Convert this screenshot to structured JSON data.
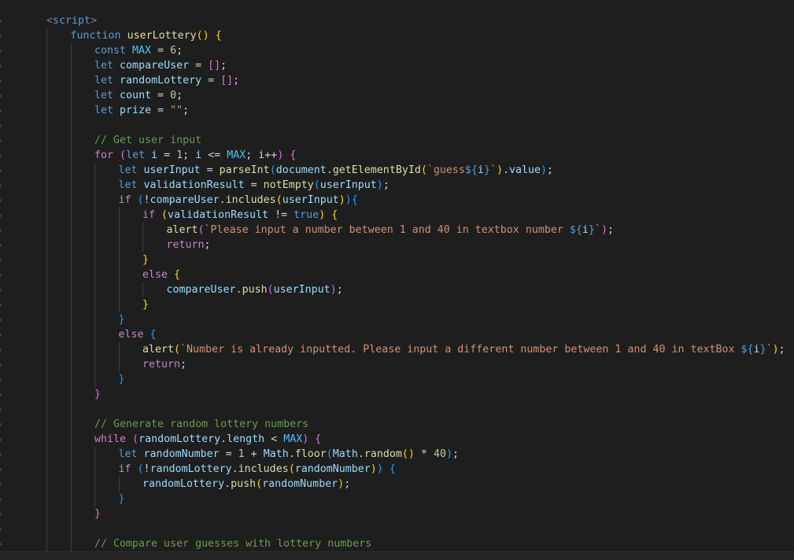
{
  "editor": {
    "language": "javascript",
    "theme_colors": {
      "background": "#1e1e1e",
      "keyword": "#569cd6",
      "control": "#c586c0",
      "function": "#dcdcaa",
      "variable": "#9cdcfe",
      "constant": "#4fc1ff",
      "number": "#b5cea8",
      "string": "#ce9178",
      "comment": "#6a9955",
      "bracket_level_1": "#ffd700",
      "bracket_level_2": "#da70d6",
      "bracket_level_3": "#179fff"
    },
    "lines": [
      {
        "indent": 1,
        "tokens": [
          [
            "tag",
            "<"
          ],
          [
            "tagn",
            "script"
          ],
          [
            "tag",
            ">"
          ]
        ]
      },
      {
        "indent": 2,
        "tokens": [
          [
            "kw",
            "function"
          ],
          [
            "op",
            " "
          ],
          [
            "fn",
            "userLottery"
          ],
          [
            "p1",
            "()"
          ],
          [
            "op",
            " "
          ],
          [
            "p1",
            "{"
          ]
        ]
      },
      {
        "indent": 3,
        "tokens": [
          [
            "kw",
            "const"
          ],
          [
            "op",
            " "
          ],
          [
            "cst",
            "MAX"
          ],
          [
            "op",
            " = "
          ],
          [
            "num",
            "6"
          ],
          [
            "op",
            ";"
          ]
        ]
      },
      {
        "indent": 3,
        "tokens": [
          [
            "kw",
            "let"
          ],
          [
            "op",
            " "
          ],
          [
            "var",
            "compareUser"
          ],
          [
            "op",
            " = "
          ],
          [
            "p2",
            "[]"
          ],
          [
            "op",
            ";"
          ]
        ]
      },
      {
        "indent": 3,
        "tokens": [
          [
            "kw",
            "let"
          ],
          [
            "op",
            " "
          ],
          [
            "var",
            "randomLottery"
          ],
          [
            "op",
            " = "
          ],
          [
            "p2",
            "[]"
          ],
          [
            "op",
            ";"
          ]
        ]
      },
      {
        "indent": 3,
        "tokens": [
          [
            "kw",
            "let"
          ],
          [
            "op",
            " "
          ],
          [
            "var",
            "count"
          ],
          [
            "op",
            " = "
          ],
          [
            "num",
            "0"
          ],
          [
            "op",
            ";"
          ]
        ]
      },
      {
        "indent": 3,
        "tokens": [
          [
            "kw",
            "let"
          ],
          [
            "op",
            " "
          ],
          [
            "var",
            "prize"
          ],
          [
            "op",
            " = "
          ],
          [
            "str",
            "\"\""
          ],
          [
            "op",
            ";"
          ]
        ]
      },
      {
        "indent": 3,
        "tokens": []
      },
      {
        "indent": 3,
        "tokens": [
          [
            "cmt",
            "// Get user input"
          ]
        ]
      },
      {
        "indent": 3,
        "tokens": [
          [
            "ctl",
            "for"
          ],
          [
            "op",
            " "
          ],
          [
            "p2",
            "("
          ],
          [
            "kw",
            "let"
          ],
          [
            "op",
            " "
          ],
          [
            "var",
            "i"
          ],
          [
            "op",
            " = "
          ],
          [
            "num",
            "1"
          ],
          [
            "op",
            "; "
          ],
          [
            "var",
            "i"
          ],
          [
            "op",
            " <= "
          ],
          [
            "cst",
            "MAX"
          ],
          [
            "op",
            "; "
          ],
          [
            "var",
            "i"
          ],
          [
            "op",
            "++"
          ],
          [
            "p2",
            ")"
          ],
          [
            "op",
            " "
          ],
          [
            "p2",
            "{"
          ]
        ]
      },
      {
        "indent": 4,
        "tokens": [
          [
            "kw",
            "let"
          ],
          [
            "op",
            " "
          ],
          [
            "var",
            "userInput"
          ],
          [
            "op",
            " = "
          ],
          [
            "fn",
            "parseInt"
          ],
          [
            "p3",
            "("
          ],
          [
            "var",
            "document"
          ],
          [
            "op",
            "."
          ],
          [
            "fn",
            "getElementById"
          ],
          [
            "p1",
            "("
          ],
          [
            "str",
            "`guess"
          ],
          [
            "tpl",
            "${"
          ],
          [
            "var",
            "i"
          ],
          [
            "tpl",
            "}"
          ],
          [
            "str",
            "`"
          ],
          [
            "p1",
            ")"
          ],
          [
            "op",
            "."
          ],
          [
            "var",
            "value"
          ],
          [
            "p3",
            ")"
          ],
          [
            "op",
            ";"
          ]
        ]
      },
      {
        "indent": 4,
        "tokens": [
          [
            "kw",
            "let"
          ],
          [
            "op",
            " "
          ],
          [
            "var",
            "validationResult"
          ],
          [
            "op",
            " = "
          ],
          [
            "fn",
            "notEmpty"
          ],
          [
            "p3",
            "("
          ],
          [
            "var",
            "userInput"
          ],
          [
            "p3",
            ")"
          ],
          [
            "op",
            ";"
          ]
        ]
      },
      {
        "indent": 4,
        "tokens": [
          [
            "ctl",
            "if"
          ],
          [
            "op",
            " "
          ],
          [
            "p3",
            "("
          ],
          [
            "op",
            "!"
          ],
          [
            "var",
            "compareUser"
          ],
          [
            "op",
            "."
          ],
          [
            "fn",
            "includes"
          ],
          [
            "p1",
            "("
          ],
          [
            "var",
            "userInput"
          ],
          [
            "p1",
            ")"
          ],
          [
            "p3",
            ")"
          ],
          [
            "p3",
            "{"
          ]
        ]
      },
      {
        "indent": 5,
        "tokens": [
          [
            "ctl",
            "if"
          ],
          [
            "op",
            " "
          ],
          [
            "p1",
            "("
          ],
          [
            "var",
            "validationResult"
          ],
          [
            "op",
            " != "
          ],
          [
            "kw",
            "true"
          ],
          [
            "p1",
            ")"
          ],
          [
            "op",
            " "
          ],
          [
            "p1",
            "{"
          ]
        ]
      },
      {
        "indent": 6,
        "tokens": [
          [
            "fn",
            "alert"
          ],
          [
            "p2",
            "("
          ],
          [
            "str",
            "`Please input a number between 1 and 40 in textbox number "
          ],
          [
            "tpl",
            "${"
          ],
          [
            "var",
            "i"
          ],
          [
            "tpl",
            "}"
          ],
          [
            "str",
            "`"
          ],
          [
            "p2",
            ")"
          ],
          [
            "op",
            ";"
          ]
        ]
      },
      {
        "indent": 6,
        "tokens": [
          [
            "ctl",
            "return"
          ],
          [
            "op",
            ";"
          ]
        ]
      },
      {
        "indent": 5,
        "tokens": [
          [
            "p1",
            "}"
          ]
        ]
      },
      {
        "indent": 5,
        "tokens": [
          [
            "ctl",
            "else"
          ],
          [
            "op",
            " "
          ],
          [
            "p1",
            "{"
          ]
        ]
      },
      {
        "indent": 6,
        "tokens": [
          [
            "var",
            "compareUser"
          ],
          [
            "op",
            "."
          ],
          [
            "fn",
            "push"
          ],
          [
            "p2",
            "("
          ],
          [
            "var",
            "userInput"
          ],
          [
            "p2",
            ")"
          ],
          [
            "op",
            ";"
          ]
        ]
      },
      {
        "indent": 5,
        "tokens": [
          [
            "p1",
            "}"
          ]
        ]
      },
      {
        "indent": 4,
        "tokens": [
          [
            "p3",
            "}"
          ]
        ]
      },
      {
        "indent": 4,
        "tokens": [
          [
            "ctl",
            "else"
          ],
          [
            "op",
            " "
          ],
          [
            "p3",
            "{"
          ]
        ]
      },
      {
        "indent": 5,
        "tokens": [
          [
            "fn",
            "alert"
          ],
          [
            "p1",
            "("
          ],
          [
            "str",
            "`Number is already inputted. Please input a different number between 1 and 40 in textBox "
          ],
          [
            "tpl",
            "${"
          ],
          [
            "var",
            "i"
          ],
          [
            "tpl",
            "}"
          ],
          [
            "str",
            "`"
          ],
          [
            "p1",
            ")"
          ],
          [
            "op",
            ";"
          ]
        ]
      },
      {
        "indent": 5,
        "tokens": [
          [
            "ctl",
            "return"
          ],
          [
            "op",
            ";"
          ]
        ]
      },
      {
        "indent": 4,
        "tokens": [
          [
            "p3",
            "}"
          ]
        ]
      },
      {
        "indent": 3,
        "tokens": [
          [
            "p2",
            "}"
          ]
        ]
      },
      {
        "indent": 3,
        "tokens": []
      },
      {
        "indent": 3,
        "tokens": [
          [
            "cmt",
            "// Generate random lottery numbers"
          ]
        ]
      },
      {
        "indent": 3,
        "tokens": [
          [
            "ctl",
            "while"
          ],
          [
            "op",
            " "
          ],
          [
            "p2",
            "("
          ],
          [
            "var",
            "randomLottery"
          ],
          [
            "op",
            "."
          ],
          [
            "var",
            "length"
          ],
          [
            "op",
            " < "
          ],
          [
            "cst",
            "MAX"
          ],
          [
            "p2",
            ")"
          ],
          [
            "op",
            " "
          ],
          [
            "p2",
            "{"
          ]
        ]
      },
      {
        "indent": 4,
        "tokens": [
          [
            "kw",
            "let"
          ],
          [
            "op",
            " "
          ],
          [
            "var",
            "randomNumber"
          ],
          [
            "op",
            " = "
          ],
          [
            "num",
            "1"
          ],
          [
            "op",
            " + "
          ],
          [
            "var",
            "Math"
          ],
          [
            "op",
            "."
          ],
          [
            "fn",
            "floor"
          ],
          [
            "p3",
            "("
          ],
          [
            "var",
            "Math"
          ],
          [
            "op",
            "."
          ],
          [
            "fn",
            "random"
          ],
          [
            "p1",
            "()"
          ],
          [
            "op",
            " * "
          ],
          [
            "num",
            "40"
          ],
          [
            "p3",
            ")"
          ],
          [
            "op",
            ";"
          ]
        ]
      },
      {
        "indent": 4,
        "tokens": [
          [
            "ctl",
            "if"
          ],
          [
            "op",
            " "
          ],
          [
            "p3",
            "("
          ],
          [
            "op",
            "!"
          ],
          [
            "var",
            "randomLottery"
          ],
          [
            "op",
            "."
          ],
          [
            "fn",
            "includes"
          ],
          [
            "p1",
            "("
          ],
          [
            "var",
            "randomNumber"
          ],
          [
            "p1",
            ")"
          ],
          [
            "p3",
            ")"
          ],
          [
            "op",
            " "
          ],
          [
            "p3",
            "{"
          ]
        ]
      },
      {
        "indent": 5,
        "tokens": [
          [
            "var",
            "randomLottery"
          ],
          [
            "op",
            "."
          ],
          [
            "fn",
            "push"
          ],
          [
            "p1",
            "("
          ],
          [
            "var",
            "randomNumber"
          ],
          [
            "p1",
            ")"
          ],
          [
            "op",
            ";"
          ]
        ]
      },
      {
        "indent": 4,
        "tokens": [
          [
            "p3",
            "}"
          ]
        ]
      },
      {
        "indent": 3,
        "tokens": [
          [
            "p2",
            "}"
          ]
        ]
      },
      {
        "indent": 3,
        "tokens": []
      },
      {
        "indent": 3,
        "tokens": [
          [
            "cmt",
            "// Compare user guesses with lottery numbers"
          ]
        ]
      }
    ]
  }
}
